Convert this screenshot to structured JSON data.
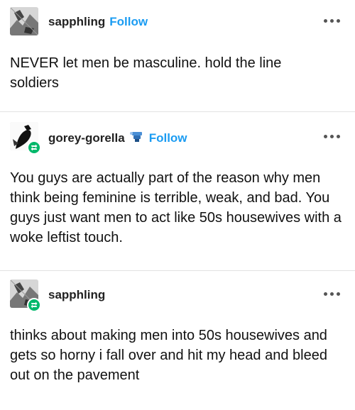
{
  "posts": [
    {
      "username": "sapphling",
      "follow_label": "Follow",
      "has_reblog_badge": false,
      "text": "NEVER let men be masculine. hold the line soldiers",
      "avatar_icon": "avatar-image",
      "more_icon": "more-options-icon"
    },
    {
      "username": "gorey-gorella",
      "follow_label": "Follow",
      "has_reblog_badge": true,
      "has_follow_icon": true,
      "text": "You guys are actually part of the reason why men think being feminine is terrible, weak, and bad. You guys just want men to act like 50s housewives with a woke leftist touch.",
      "avatar_icon": "avatar-image",
      "more_icon": "more-options-icon"
    },
    {
      "username": "sapphling",
      "has_reblog_badge": true,
      "text": "thinks about making men into 50s housewives and gets so horny i fall over and hit my head and bleed out on the pavement",
      "avatar_icon": "avatar-image",
      "more_icon": "more-options-icon"
    }
  ],
  "colors": {
    "follow_blue": "#1b9cf2",
    "reblog_green": "#00b86b",
    "divider": "#e2e2e2",
    "text": "#111111"
  }
}
